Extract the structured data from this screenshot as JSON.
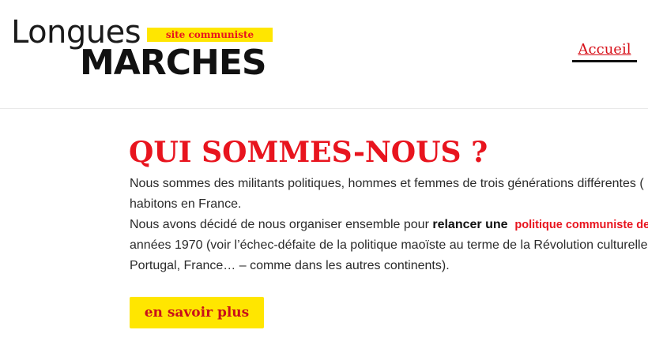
{
  "logo": {
    "light_text": "Longues",
    "tagline": "site communiste",
    "bold_text": "MARCHES"
  },
  "nav": {
    "home_label": "Accueil"
  },
  "main": {
    "title": "QUI SOMMES-NOUS ?",
    "para1_line1": "Nous sommes des militants politiques, hommes et femmes de trois générations différentes (",
    "para1_line2": "habitons en France.",
    "para2_line1_a": "Nous avons décidé de nous organiser ensemble pour ",
    "para2_line1_bold": "relancer une",
    "para2_line1_red": "politique communiste de",
    "para2_line2": "années 1970 (voir l’échec-défaite de la politique maoïste au terme de la Révolution culturelle,",
    "para2_line3": "Portugal, France… – comme dans les autres continents).",
    "cta_label": "en savoir plus"
  },
  "colors": {
    "accent_red": "#e8141e",
    "accent_yellow": "#ffe600",
    "text_dark": "#111111"
  }
}
